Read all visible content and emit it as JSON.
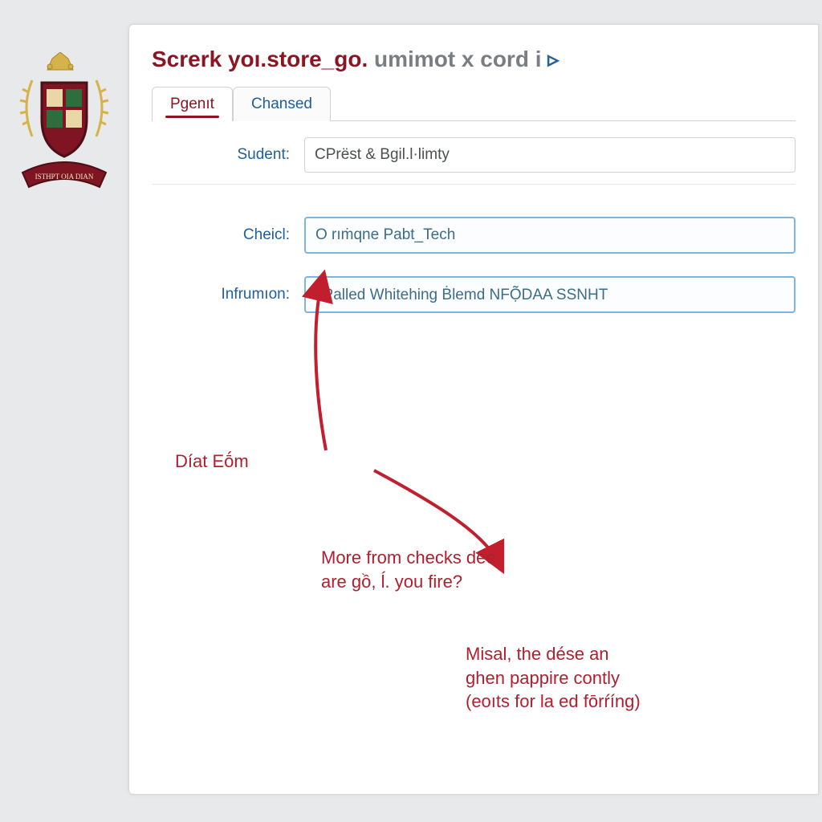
{
  "header": {
    "title_red": "Screrk yoı.store_go.",
    "title_gray": " umimot x cord i",
    "icon_glyph": "▹"
  },
  "tabs": [
    {
      "label": "Pgenıt",
      "active": true
    },
    {
      "label": "Chansed",
      "active": false
    }
  ],
  "fields": {
    "sudent": {
      "label": "Sudent:",
      "value": "CPrëst & Bgil.l·limty"
    },
    "cheicl": {
      "label": "Cheicl:",
      "value": "O rıṁqne Pabt_Tech"
    },
    "infrumion": {
      "label": "Infrumıon:",
      "value": "▹Palled Whitehing Ḃlemd NFỌ̃DAA SSNHT"
    }
  },
  "annotations": {
    "a1": "Díat Eṓm",
    "a2_line1": "More from checks dee",
    "a2_line2": "are gồ, ĺ. you fire?",
    "a3_line1": "Misal, the dése an",
    "a3_line2": "ghen pappire contly",
    "a3_line3": "(eoıts for la ed fōrŕíng)"
  },
  "logo_banner_text": "ISTHPT OIA DIAN"
}
